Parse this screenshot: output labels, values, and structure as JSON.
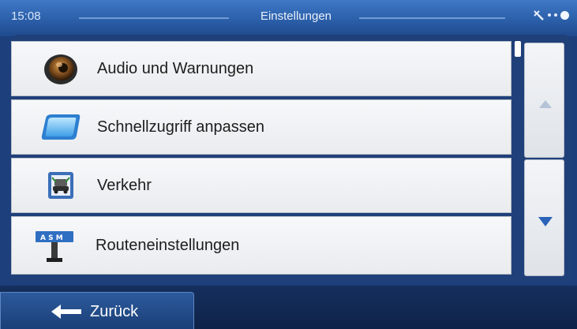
{
  "status": {
    "time": "15:08",
    "title": "Einstellungen"
  },
  "menu": {
    "items": [
      {
        "label": "Audio und Warnungen",
        "icon": "speaker-icon"
      },
      {
        "label": "Schnellzugriff anpassen",
        "icon": "quick-access-icon"
      },
      {
        "label": "Verkehr",
        "icon": "traffic-icon"
      },
      {
        "label": "Routeneinstellungen",
        "icon": "route-settings-icon"
      }
    ]
  },
  "nav": {
    "back_label": "Zurück"
  },
  "colors": {
    "accent": "#2a63b8",
    "panel": "#20407a",
    "row": "#eef0f3"
  }
}
